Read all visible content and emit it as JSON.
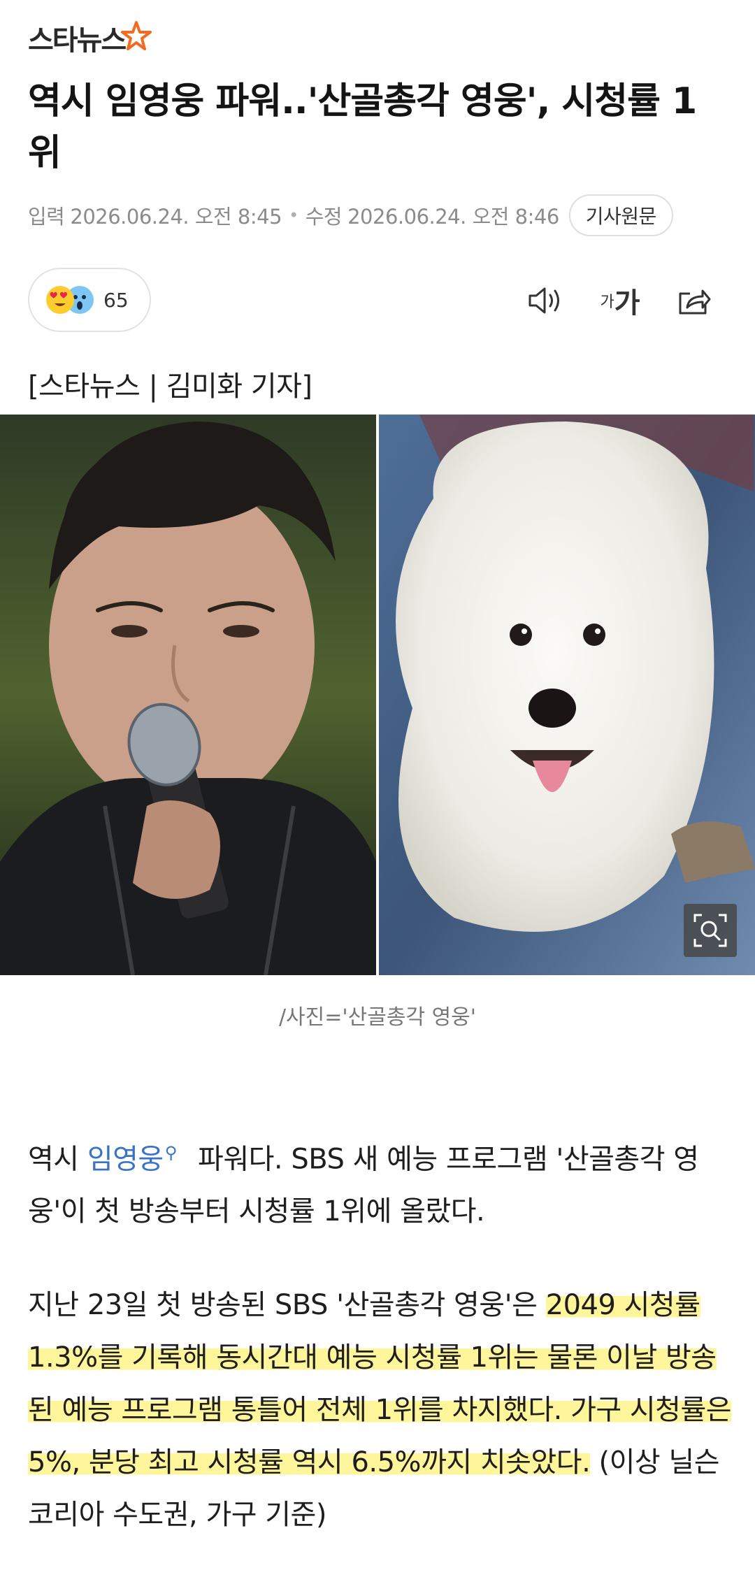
{
  "header": {
    "logo_text": "스타뉴스"
  },
  "article": {
    "title": "역시 임영웅 파워..'산골총각 영웅', 시청률 1위",
    "meta": {
      "input_label": "입력",
      "input_time": "2026.06.24. 오전 8:45",
      "edit_label": "수정",
      "edit_time": "2026.06.24. 오전 8:46",
      "source_button": "기사원문"
    },
    "reactions": {
      "count": "65",
      "emojis": [
        "heart-eyes-emoji",
        "shocked-face-emoji"
      ]
    },
    "tools": {
      "font_small": "가",
      "font_big": "가"
    },
    "byline": "[스타뉴스 | 김미화 기자]",
    "photo_caption": "/사진='산골총각 영웅'",
    "paragraph1": {
      "before": "역시 ",
      "keyword": "임영웅",
      "after": " 파워다. SBS 새 예능 프로그램 '산골총각 영웅'이 첫 방송부터 시청률 1위에 올랐다."
    },
    "paragraph2": {
      "plain1": "지난 23일 첫 방송된 SBS '산골총각 영웅'은 ",
      "highlight": "2049 시청률 1.3%를 기록해 동시간대 예능 시청률 1위는 물론 이날 방송된 예능 프로그램 통틀어 전체 1위를 차지했다. 가구 시청률은 5%, 분당 최고 시청률 역시 6.5%까지 치솟았다.",
      "plain2": " (이상 닐슨코리아 수도권, 가구 기준)"
    }
  },
  "colors": {
    "keyword": "#3a72c8",
    "highlight": "#fff59a",
    "logo_star": "#f26b21"
  }
}
